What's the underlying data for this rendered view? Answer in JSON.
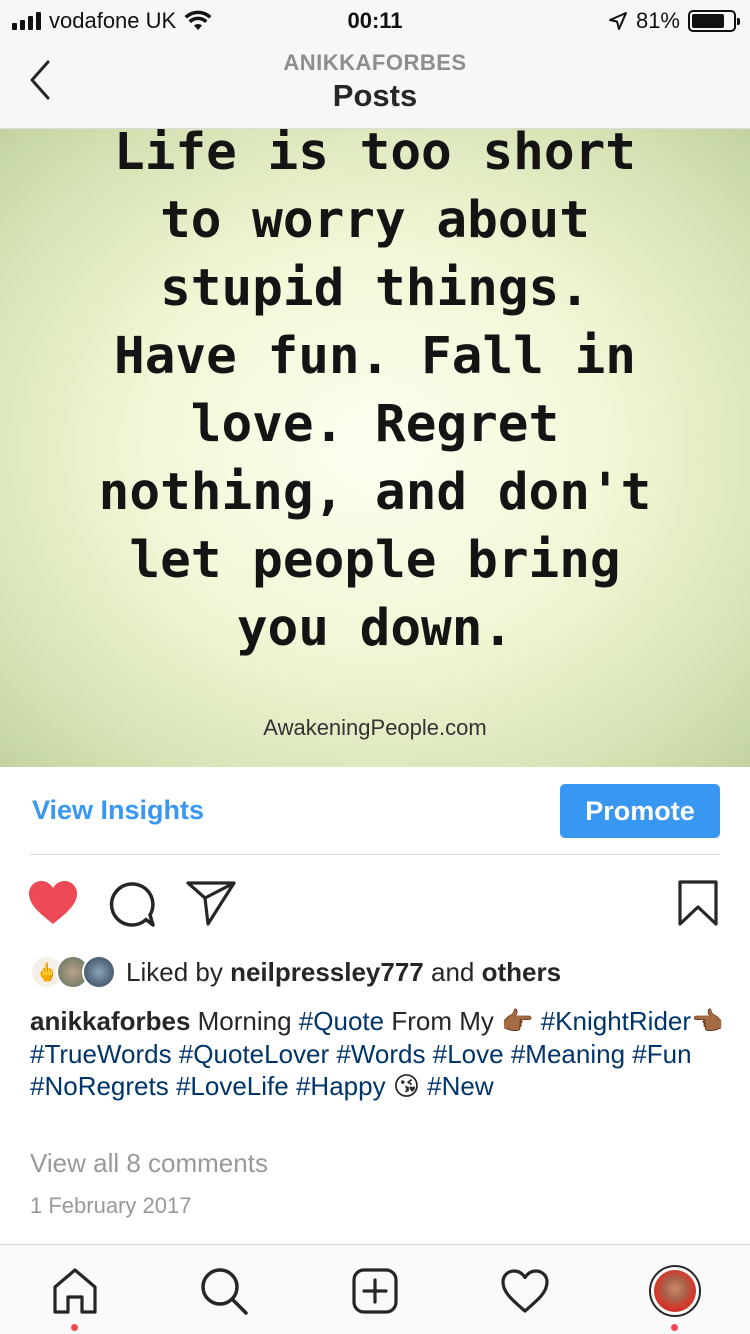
{
  "status_bar": {
    "carrier": "vodafone UK",
    "time": "00:11",
    "battery": "81%",
    "battery_level": 0.81
  },
  "header": {
    "username": "ANIKKAFORBES",
    "title": "Posts"
  },
  "post": {
    "quote_lines": [
      "Life is too short",
      "to worry about",
      "stupid things.",
      "Have fun. Fall in",
      "love. Regret",
      "nothing, and don't",
      "let people bring",
      "you down."
    ],
    "watermark": "AwakeningPeople.com"
  },
  "insights": {
    "view_insights_label": "View Insights",
    "promote_label": "Promote"
  },
  "actions": {
    "like_icon": "heart-filled-icon",
    "comment_icon": "comment-icon",
    "share_icon": "paper-plane-icon",
    "save_icon": "bookmark-icon",
    "like_color": "#ed4956"
  },
  "likes": {
    "prefix": "Liked by ",
    "user": "neilpressley777",
    "middle": " and ",
    "others": "others"
  },
  "caption": {
    "username": "anikkaforbes",
    "text": " Morning ",
    "tags1": [
      "#Quote"
    ],
    "text2": " From My ",
    "emoji1": "👉🏾",
    "tag_knight": "#KnightRider",
    "emoji2": "👈🏾",
    "tags_rest": [
      "#TrueWords",
      "#QuoteLover",
      "#Words",
      "#Love",
      "#Meaning",
      "#Fun",
      "#NoRegrets",
      "#LoveLife",
      "#Happy"
    ],
    "emoji3": "😘",
    "tag_last": "#New"
  },
  "comments_link": "View all 8 comments",
  "date": "1 February 2017",
  "tabbar": {
    "items": [
      "home-icon",
      "search-icon",
      "add-post-icon",
      "activity-heart-icon",
      "profile-avatar"
    ],
    "accent": "#ed4956"
  },
  "colors": {
    "link_blue": "#3897f0",
    "hashtag": "#003569",
    "muted": "#999999"
  }
}
